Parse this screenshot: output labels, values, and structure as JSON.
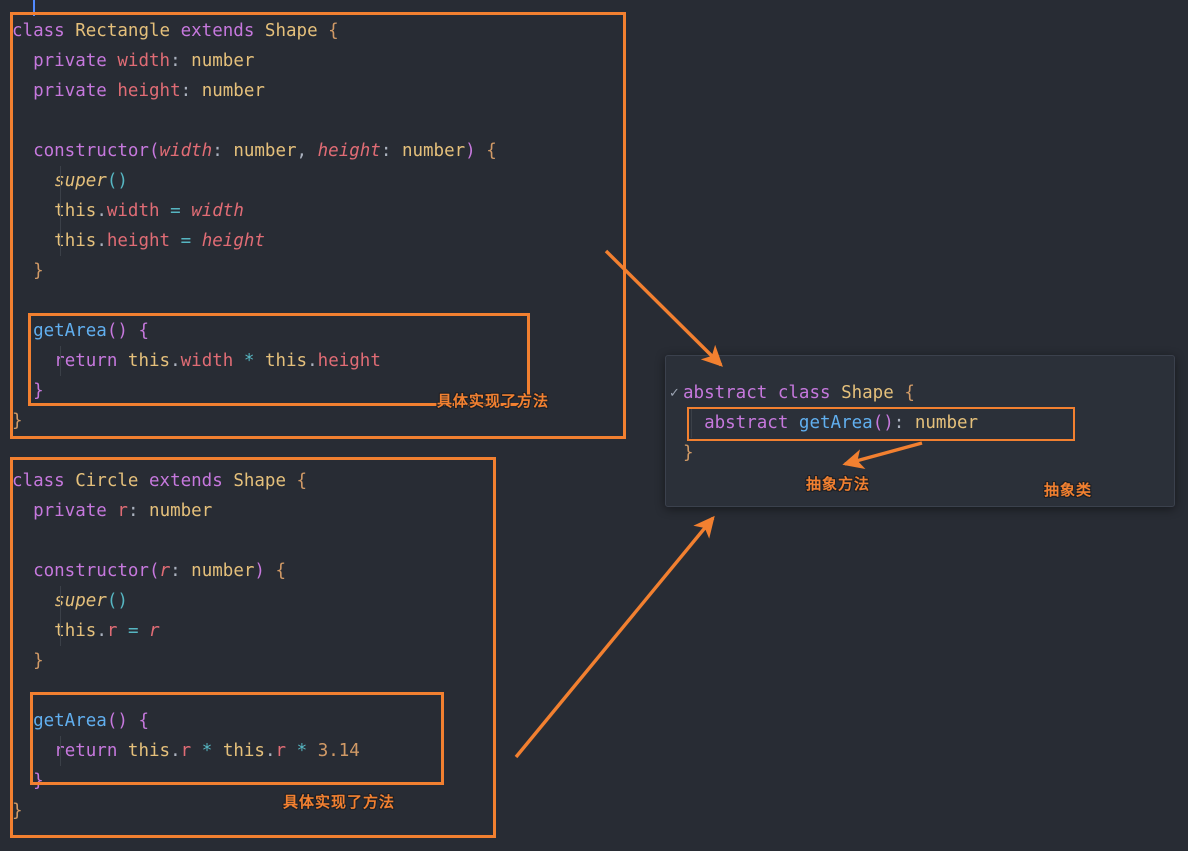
{
  "theme": {
    "background": "#282c34",
    "panel_background": "#2b3039",
    "annotation_color": "#f28030",
    "keyword": "#c678dd",
    "type": "#e5c07b",
    "function": "#61afef",
    "property": "#e06c75",
    "operator": "#56b6c2",
    "number": "#d19a66",
    "cursor": "#528bff"
  },
  "code": {
    "rectangle_class": {
      "lines": [
        [
          {
            "t": "class",
            "c": "tok-kw"
          },
          {
            "t": " ",
            "c": "tok-plain"
          },
          {
            "t": "Rectangle",
            "c": "tok-type"
          },
          {
            "t": " ",
            "c": "tok-plain"
          },
          {
            "t": "extends",
            "c": "tok-kw"
          },
          {
            "t": " ",
            "c": "tok-plain"
          },
          {
            "t": "Shape",
            "c": "tok-type"
          },
          {
            "t": " ",
            "c": "tok-plain"
          },
          {
            "t": "{",
            "c": "tok-brace"
          }
        ],
        [
          {
            "t": "  ",
            "c": "tok-plain"
          },
          {
            "t": "private",
            "c": "tok-kw"
          },
          {
            "t": " ",
            "c": "tok-plain"
          },
          {
            "t": "width",
            "c": "tok-prop"
          },
          {
            "t": ":",
            "c": "tok-punct"
          },
          {
            "t": " ",
            "c": "tok-plain"
          },
          {
            "t": "number",
            "c": "tok-type"
          }
        ],
        [
          {
            "t": "  ",
            "c": "tok-plain"
          },
          {
            "t": "private",
            "c": "tok-kw"
          },
          {
            "t": " ",
            "c": "tok-plain"
          },
          {
            "t": "height",
            "c": "tok-prop"
          },
          {
            "t": ":",
            "c": "tok-punct"
          },
          {
            "t": " ",
            "c": "tok-plain"
          },
          {
            "t": "number",
            "c": "tok-type"
          }
        ],
        [],
        [
          {
            "t": "  ",
            "c": "tok-plain"
          },
          {
            "t": "constructor",
            "c": "tok-kw"
          },
          {
            "t": "(",
            "c": "tok-paren"
          },
          {
            "t": "width",
            "c": "tok-param"
          },
          {
            "t": ":",
            "c": "tok-punct"
          },
          {
            "t": " ",
            "c": "tok-plain"
          },
          {
            "t": "number",
            "c": "tok-type"
          },
          {
            "t": ",",
            "c": "tok-punct"
          },
          {
            "t": " ",
            "c": "tok-plain"
          },
          {
            "t": "height",
            "c": "tok-param"
          },
          {
            "t": ":",
            "c": "tok-punct"
          },
          {
            "t": " ",
            "c": "tok-plain"
          },
          {
            "t": "number",
            "c": "tok-type"
          },
          {
            "t": ")",
            "c": "tok-paren"
          },
          {
            "t": " ",
            "c": "tok-plain"
          },
          {
            "t": "{",
            "c": "tok-brace"
          }
        ],
        [
          {
            "t": "    ",
            "c": "tok-plain"
          },
          {
            "t": "super",
            "c": "tok-super"
          },
          {
            "t": "()",
            "c": "tok-op"
          }
        ],
        [
          {
            "t": "    ",
            "c": "tok-plain"
          },
          {
            "t": "this",
            "c": "tok-this"
          },
          {
            "t": ".",
            "c": "tok-punct"
          },
          {
            "t": "width",
            "c": "tok-prop"
          },
          {
            "t": " ",
            "c": "tok-plain"
          },
          {
            "t": "=",
            "c": "tok-op"
          },
          {
            "t": " ",
            "c": "tok-plain"
          },
          {
            "t": "width",
            "c": "tok-param"
          }
        ],
        [
          {
            "t": "    ",
            "c": "tok-plain"
          },
          {
            "t": "this",
            "c": "tok-this"
          },
          {
            "t": ".",
            "c": "tok-punct"
          },
          {
            "t": "height",
            "c": "tok-prop"
          },
          {
            "t": " ",
            "c": "tok-plain"
          },
          {
            "t": "=",
            "c": "tok-op"
          },
          {
            "t": " ",
            "c": "tok-plain"
          },
          {
            "t": "height",
            "c": "tok-param"
          }
        ],
        [
          {
            "t": "  ",
            "c": "tok-plain"
          },
          {
            "t": "}",
            "c": "tok-brace"
          }
        ],
        [],
        [
          {
            "t": "  ",
            "c": "tok-plain"
          },
          {
            "t": "getArea",
            "c": "tok-fn"
          },
          {
            "t": "()",
            "c": "tok-paren"
          },
          {
            "t": " ",
            "c": "tok-plain"
          },
          {
            "t": "{",
            "c": "tok-brace-p"
          }
        ],
        [
          {
            "t": "    ",
            "c": "tok-plain"
          },
          {
            "t": "return",
            "c": "tok-kw"
          },
          {
            "t": " ",
            "c": "tok-plain"
          },
          {
            "t": "this",
            "c": "tok-this"
          },
          {
            "t": ".",
            "c": "tok-punct"
          },
          {
            "t": "width",
            "c": "tok-prop"
          },
          {
            "t": " ",
            "c": "tok-plain"
          },
          {
            "t": "*",
            "c": "tok-op"
          },
          {
            "t": " ",
            "c": "tok-plain"
          },
          {
            "t": "this",
            "c": "tok-this"
          },
          {
            "t": ".",
            "c": "tok-punct"
          },
          {
            "t": "height",
            "c": "tok-prop"
          }
        ],
        [
          {
            "t": "  ",
            "c": "tok-plain"
          },
          {
            "t": "}",
            "c": "tok-brace-p"
          }
        ],
        [
          {
            "t": "}",
            "c": "tok-brace"
          }
        ]
      ]
    },
    "circle_class": {
      "lines": [
        [
          {
            "t": "class",
            "c": "tok-kw"
          },
          {
            "t": " ",
            "c": "tok-plain"
          },
          {
            "t": "Circle",
            "c": "tok-type"
          },
          {
            "t": " ",
            "c": "tok-plain"
          },
          {
            "t": "extends",
            "c": "tok-kw"
          },
          {
            "t": " ",
            "c": "tok-plain"
          },
          {
            "t": "Shape",
            "c": "tok-type"
          },
          {
            "t": " ",
            "c": "tok-plain"
          },
          {
            "t": "{",
            "c": "tok-brace"
          }
        ],
        [
          {
            "t": "  ",
            "c": "tok-plain"
          },
          {
            "t": "private",
            "c": "tok-kw"
          },
          {
            "t": " ",
            "c": "tok-plain"
          },
          {
            "t": "r",
            "c": "tok-prop"
          },
          {
            "t": ":",
            "c": "tok-punct"
          },
          {
            "t": " ",
            "c": "tok-plain"
          },
          {
            "t": "number",
            "c": "tok-type"
          }
        ],
        [],
        [
          {
            "t": "  ",
            "c": "tok-plain"
          },
          {
            "t": "constructor",
            "c": "tok-kw"
          },
          {
            "t": "(",
            "c": "tok-paren"
          },
          {
            "t": "r",
            "c": "tok-param"
          },
          {
            "t": ":",
            "c": "tok-punct"
          },
          {
            "t": " ",
            "c": "tok-plain"
          },
          {
            "t": "number",
            "c": "tok-type"
          },
          {
            "t": ")",
            "c": "tok-paren"
          },
          {
            "t": " ",
            "c": "tok-plain"
          },
          {
            "t": "{",
            "c": "tok-brace"
          }
        ],
        [
          {
            "t": "    ",
            "c": "tok-plain"
          },
          {
            "t": "super",
            "c": "tok-super"
          },
          {
            "t": "()",
            "c": "tok-op"
          }
        ],
        [
          {
            "t": "    ",
            "c": "tok-plain"
          },
          {
            "t": "this",
            "c": "tok-this"
          },
          {
            "t": ".",
            "c": "tok-punct"
          },
          {
            "t": "r",
            "c": "tok-prop"
          },
          {
            "t": " ",
            "c": "tok-plain"
          },
          {
            "t": "=",
            "c": "tok-op"
          },
          {
            "t": " ",
            "c": "tok-plain"
          },
          {
            "t": "r",
            "c": "tok-param"
          }
        ],
        [
          {
            "t": "  ",
            "c": "tok-plain"
          },
          {
            "t": "}",
            "c": "tok-brace"
          }
        ],
        [],
        [
          {
            "t": "  ",
            "c": "tok-plain"
          },
          {
            "t": "getArea",
            "c": "tok-fn"
          },
          {
            "t": "()",
            "c": "tok-paren"
          },
          {
            "t": " ",
            "c": "tok-plain"
          },
          {
            "t": "{",
            "c": "tok-brace-p"
          }
        ],
        [
          {
            "t": "    ",
            "c": "tok-plain"
          },
          {
            "t": "return",
            "c": "tok-kw"
          },
          {
            "t": " ",
            "c": "tok-plain"
          },
          {
            "t": "this",
            "c": "tok-this"
          },
          {
            "t": ".",
            "c": "tok-punct"
          },
          {
            "t": "r",
            "c": "tok-prop"
          },
          {
            "t": " ",
            "c": "tok-plain"
          },
          {
            "t": "*",
            "c": "tok-op"
          },
          {
            "t": " ",
            "c": "tok-plain"
          },
          {
            "t": "this",
            "c": "tok-this"
          },
          {
            "t": ".",
            "c": "tok-punct"
          },
          {
            "t": "r",
            "c": "tok-prop"
          },
          {
            "t": " ",
            "c": "tok-plain"
          },
          {
            "t": "*",
            "c": "tok-op"
          },
          {
            "t": " ",
            "c": "tok-plain"
          },
          {
            "t": "3.14",
            "c": "tok-num"
          }
        ],
        [
          {
            "t": "  ",
            "c": "tok-plain"
          },
          {
            "t": "}",
            "c": "tok-brace-p"
          }
        ],
        [
          {
            "t": "}",
            "c": "tok-brace"
          }
        ]
      ]
    },
    "shape_class": {
      "fold_marker": "✓",
      "lines": [
        [
          {
            "t": "abstract",
            "c": "tok-kw"
          },
          {
            "t": " ",
            "c": "tok-plain"
          },
          {
            "t": "class",
            "c": "tok-kw"
          },
          {
            "t": " ",
            "c": "tok-plain"
          },
          {
            "t": "Shape",
            "c": "tok-type"
          },
          {
            "t": " ",
            "c": "tok-plain"
          },
          {
            "t": "{",
            "c": "tok-brace"
          }
        ],
        [
          {
            "t": "  ",
            "c": "tok-plain"
          },
          {
            "t": "abstract",
            "c": "tok-kw"
          },
          {
            "t": " ",
            "c": "tok-plain"
          },
          {
            "t": "getArea",
            "c": "tok-fn"
          },
          {
            "t": "()",
            "c": "tok-paren"
          },
          {
            "t": ":",
            "c": "tok-punct"
          },
          {
            "t": " ",
            "c": "tok-plain"
          },
          {
            "t": "number",
            "c": "tok-type"
          }
        ],
        [
          {
            "t": "}",
            "c": "tok-brace"
          }
        ]
      ]
    }
  },
  "annotations": {
    "rectangle_impl_label": "具体实现了方法",
    "circle_impl_label": "具体实现了方法",
    "abstract_method_label": "抽象方法",
    "abstract_class_label": "抽象类"
  }
}
